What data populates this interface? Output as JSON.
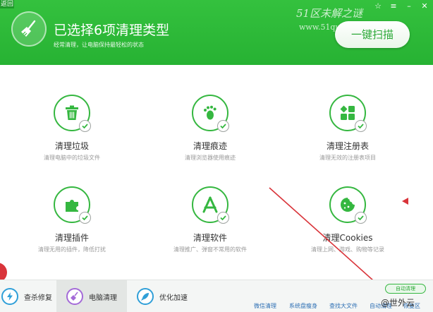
{
  "window": {
    "back_label": "返回",
    "controls": [
      "☆",
      "≡",
      "–",
      "✕"
    ]
  },
  "header": {
    "title": "已选择6项清理类型",
    "subtitle": "经常清理，让电脑保持最轻松的状态",
    "scan_button": "一键扫描"
  },
  "watermark": {
    "name": "51区未解之谜",
    "url": "www.51qumi.com"
  },
  "items": [
    {
      "icon": "trash-icon",
      "title": "清理垃圾",
      "desc": "清理电脑中的垃圾文件",
      "checked": true
    },
    {
      "icon": "footprint-icon",
      "title": "清理痕迹",
      "desc": "清理浏览器使用痕迹",
      "checked": true
    },
    {
      "icon": "registry-icon",
      "title": "清理注册表",
      "desc": "清理无效的注册表项目",
      "checked": true
    },
    {
      "icon": "plugin-icon",
      "title": "清理插件",
      "desc": "清理无用的插件，降低打扰",
      "checked": true
    },
    {
      "icon": "app-store-icon",
      "title": "清理软件",
      "desc": "清理推广、弹窗不常用的软件",
      "checked": true
    },
    {
      "icon": "cookie-icon",
      "title": "清理Cookies",
      "desc": "清理上网、游戏、购物等记录",
      "checked": true
    }
  ],
  "bottom_nav": [
    {
      "icon": "lightning-icon",
      "label": "查杀修复"
    },
    {
      "icon": "broom-icon",
      "label": "电脑清理"
    },
    {
      "icon": "rocket-icon",
      "label": "优化加速"
    }
  ],
  "links": [
    "微信清理",
    "系统盘瘦身",
    "查找大文件",
    "自动清理",
    "恢复区"
  ],
  "auto_badge": "自动清理",
  "credit": "@世外云",
  "colors": {
    "accent_green": "#2fba3a",
    "annotation_red": "#d9343a",
    "link_blue": "#2d6fb4"
  }
}
